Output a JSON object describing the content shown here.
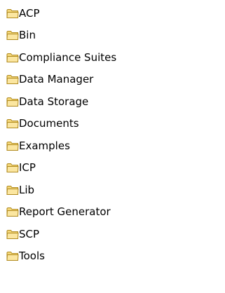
{
  "folders": [
    {
      "label": "ACP",
      "icon": "folder-icon"
    },
    {
      "label": "Bin",
      "icon": "folder-icon"
    },
    {
      "label": "Compliance Suites",
      "icon": "folder-icon"
    },
    {
      "label": "Data Manager",
      "icon": "folder-icon"
    },
    {
      "label": "Data Storage",
      "icon": "folder-icon"
    },
    {
      "label": "Documents",
      "icon": "folder-icon"
    },
    {
      "label": "Examples",
      "icon": "folder-icon"
    },
    {
      "label": "ICP",
      "icon": "folder-icon"
    },
    {
      "label": "Lib",
      "icon": "folder-icon"
    },
    {
      "label": "Report Generator",
      "icon": "folder-icon"
    },
    {
      "label": "SCP",
      "icon": "folder-icon"
    },
    {
      "label": "Tools",
      "icon": "folder-icon"
    }
  ],
  "colors": {
    "folder_fill": "#F4D77A",
    "folder_outline": "#B08A1E",
    "folder_front": "#FBE6A0",
    "text": "#000000",
    "background": "#FFFFFF"
  }
}
